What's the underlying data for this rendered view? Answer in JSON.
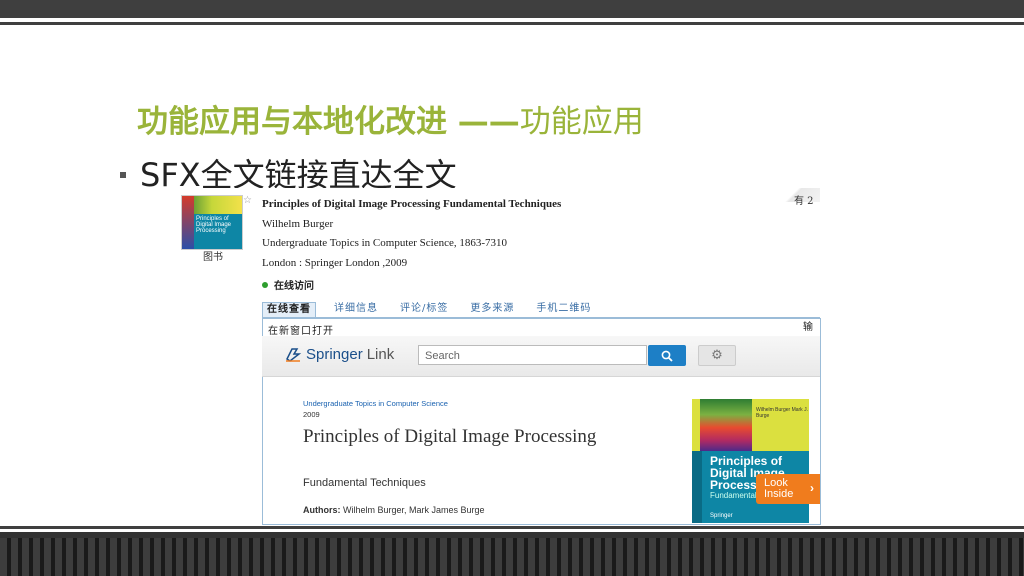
{
  "slide": {
    "title_bold": "功能应用与本地化改进 ——",
    "title_normal": "功能应用",
    "bullet": "SFX全文链接直达全文"
  },
  "record": {
    "title": "Principles of Digital Image Processing Fundamental Techniques",
    "author": "Wilhelm Burger",
    "series": "Undergraduate Topics in Computer Science, 1863-7310",
    "publisher": "London : Springer London ,2009",
    "online_access": "在线访问",
    "type_label": "图书",
    "count": "有 2",
    "thumb_title": "Principles of Digital Image Processing"
  },
  "tabs": [
    {
      "label": "在线查看"
    },
    {
      "label": "详细信息"
    },
    {
      "label": "评论/标签"
    },
    {
      "label": "更多来源"
    },
    {
      "label": "手机二维码"
    }
  ],
  "frame": {
    "open_new_window": "在新窗口打开",
    "right_edge": "输"
  },
  "springer": {
    "brand": "Springer",
    "brand_suffix": "Link",
    "search_placeholder": "Search",
    "series": "Undergraduate Topics in Computer Science",
    "year": "2009",
    "book_title": "Principles of Digital Image Processing",
    "subtitle": "Fundamental Techniques",
    "authors_label": "Authors:",
    "authors": " Wilhelm Burger, Mark James Burge",
    "cover_authors": "Wilhelm Burger Mark J. Burge",
    "cover_title": "Principles of Digital Image Processing",
    "cover_subtitle": "Fundamental T",
    "cover_publisher": "Springer",
    "look_inside": "Look Inside"
  },
  "colors": {
    "title_green": "#9ab43a",
    "springer_blue": "#1d7fc6",
    "look_orange": "#f07c1d",
    "bar_dark": "#3f3f3f"
  }
}
